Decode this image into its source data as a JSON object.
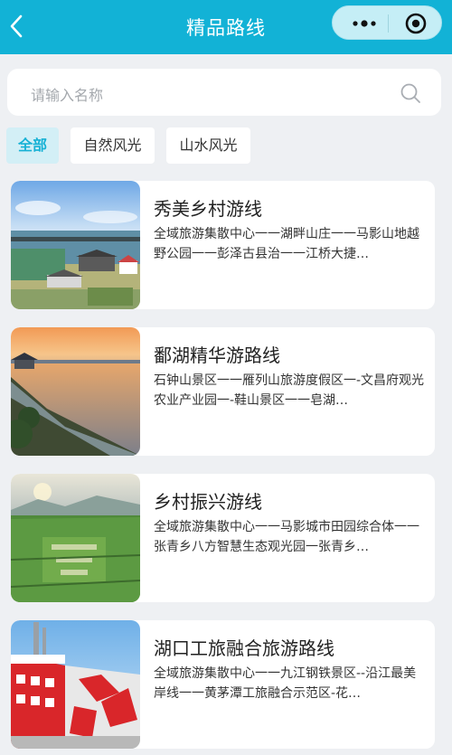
{
  "header": {
    "title": "精品路线",
    "back_icon": "chevron-left-icon",
    "more_icon": "more-dots-icon",
    "close_icon": "target-circle-icon",
    "background": "#12b2d6"
  },
  "search": {
    "placeholder": "请输入名称",
    "icon": "search-icon"
  },
  "tabs": [
    {
      "label": "全部",
      "active": true
    },
    {
      "label": "自然风光",
      "active": false
    },
    {
      "label": "山水风光",
      "active": false
    }
  ],
  "routes": [
    {
      "title": "秀美乡村游线",
      "description": "全域旅游集散中心一一湖畔山庄一一马影山地越野公园一一彭泽古县治一一江桥大捷…",
      "image": "rural-village-lake-photo"
    },
    {
      "title": "鄱湖精华游路线",
      "description": "石钟山景区一一雁列山旅游度假区一-文昌府观光农业产业园一-鞋山景区一一皂湖…",
      "image": "sunset-lakeside-pavilion-photo"
    },
    {
      "title": "乡村振兴游线",
      "description": "全域旅游集散中心一一马影城市田园综合体一一张青乡八方智慧生态观光园一张青乡…",
      "image": "green-farmland-aerial-photo"
    },
    {
      "title": "湖口工旅融合旅游路线",
      "description": "全域旅游集散中心一一九江钢铁景区--沿江最美岸线一一黄茅潭工旅融合示范区-花…",
      "image": "red-industrial-building-photo"
    }
  ]
}
